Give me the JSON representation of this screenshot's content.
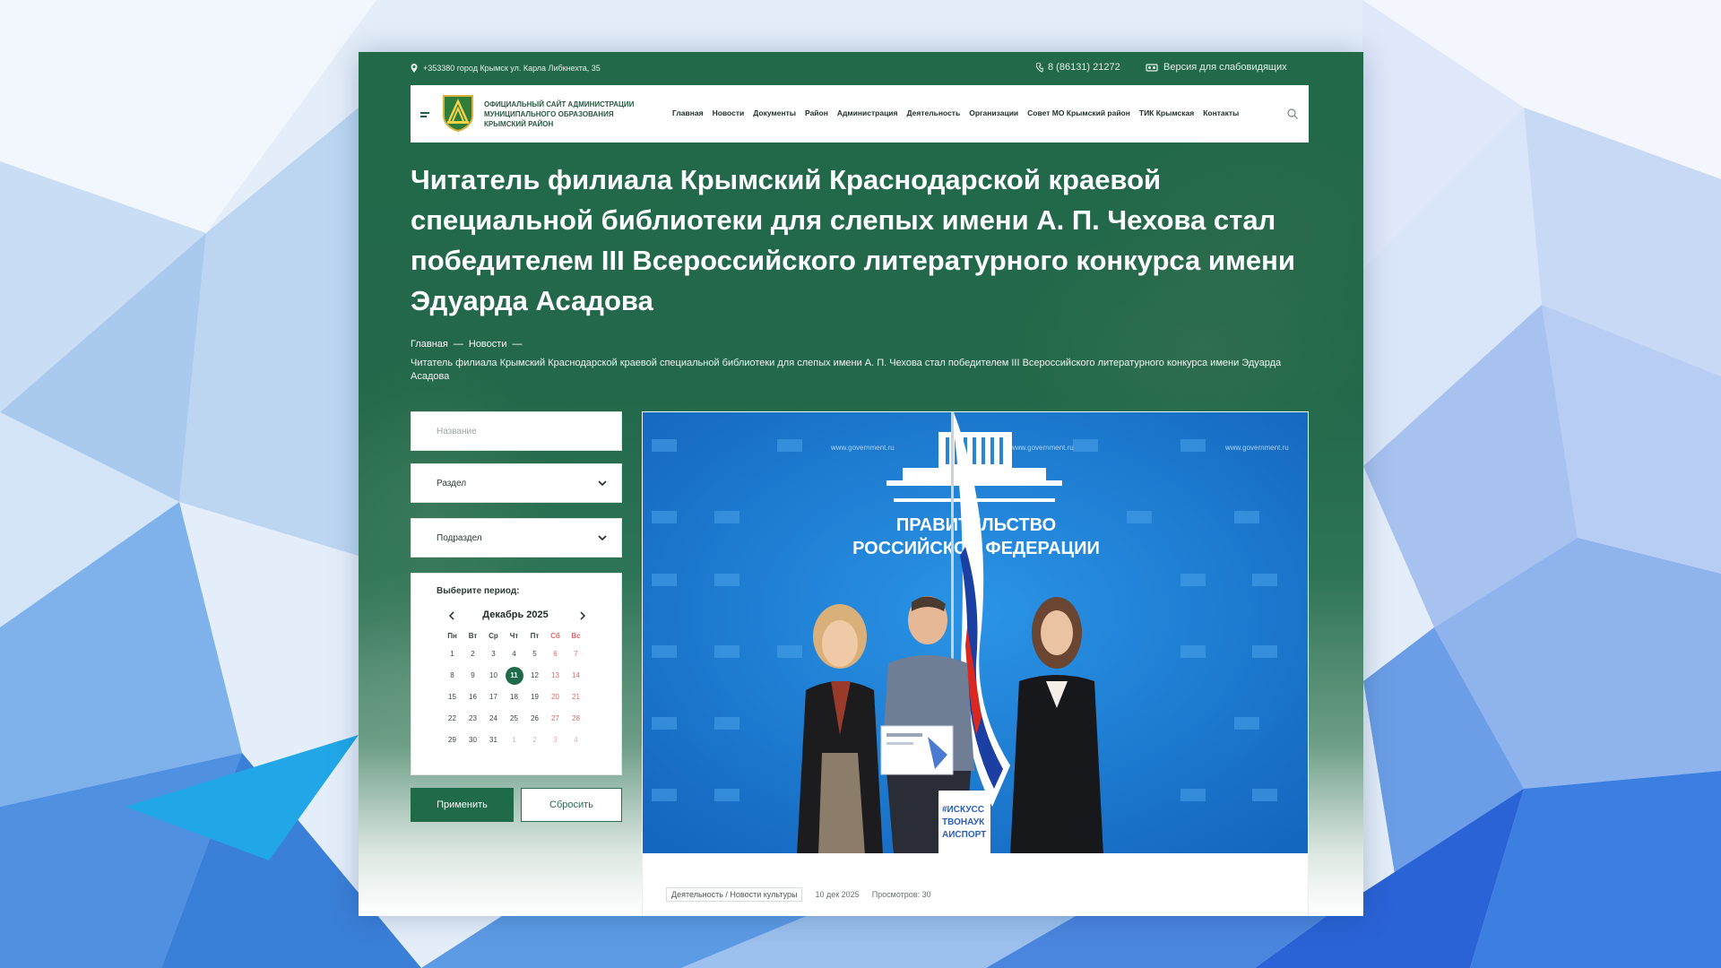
{
  "topbar": {
    "address": "+353380 город Крымск ул. Карла Либкнехта, 35",
    "phone": "8 (86131) 21272",
    "vision_version": "Версия для слабовидящих"
  },
  "header": {
    "site_title": "ОФИЦИАЛЬНЫЙ САЙТ АДМИНИСТРАЦИИ МУНИЦИПАЛЬНОГО ОБРАЗОВАНИЯ КРЫМСКИЙ РАЙОН",
    "menu": [
      "Главная",
      "Новости",
      "Документы",
      "Район",
      "Администрация",
      "Деятельность",
      "Организации",
      "Совет МО Крымский район",
      "ТИК Крымская",
      "Контакты"
    ]
  },
  "article": {
    "title": "Читатель филиала Крымский Краснодарской краевой специальной библиотеки для слепых имени А. П. Чехова стал победителем III Всероссийского литературного конкурса имени Эдуарда Асадова",
    "breadcrumb": {
      "home": "Главная",
      "news": "Новости",
      "separator": "—",
      "current": "Читатель филиала Крымский Краснодарской краевой специальной библиотеки для слепых имени А. П. Чехова стал победителем III Всероссийского литературного конкурса имени Эдуарда Асадова"
    },
    "photo": {
      "banner_line1": "ПРАВИТЕЛЬСТВО",
      "banner_line2": "РОССИЙСКОЙ ФЕДЕРАЦИИ",
      "bag_text_1": "#ИСКУСС",
      "bag_text_2": "ТВОНАУК",
      "bag_text_3": "АИСПОРТ",
      "backdrop_url": "www.government.ru"
    },
    "meta": {
      "category": "Деятельность / Новости культуры",
      "date": "10 дек 2025",
      "views": "Просмотров: 30"
    }
  },
  "filter": {
    "name_placeholder": "Название",
    "section_label": "Раздел",
    "subsection_label": "Подраздел",
    "period_label": "Выберите период:",
    "calendar": {
      "month_year": "Декабрь 2025",
      "weekdays": [
        "Пн",
        "Вт",
        "Ср",
        "Чт",
        "Пт",
        "Сб",
        "Вс"
      ],
      "weeks": [
        [
          "1",
          "2",
          "3",
          "4",
          "5",
          "6",
          "7"
        ],
        [
          "8",
          "9",
          "10",
          "11",
          "12",
          "13",
          "14"
        ],
        [
          "15",
          "16",
          "17",
          "18",
          "19",
          "20",
          "21"
        ],
        [
          "22",
          "23",
          "24",
          "25",
          "26",
          "27",
          "28"
        ],
        [
          "29",
          "30",
          "31",
          "1",
          "2",
          "3",
          "4"
        ]
      ],
      "selected_day": "11"
    },
    "apply_label": "Применить",
    "reset_label": "Сбросить"
  },
  "colors": {
    "brand_green": "#1f6a48",
    "weekend_red": "#e06a6a",
    "photo_blue": "#1e7fd0"
  }
}
